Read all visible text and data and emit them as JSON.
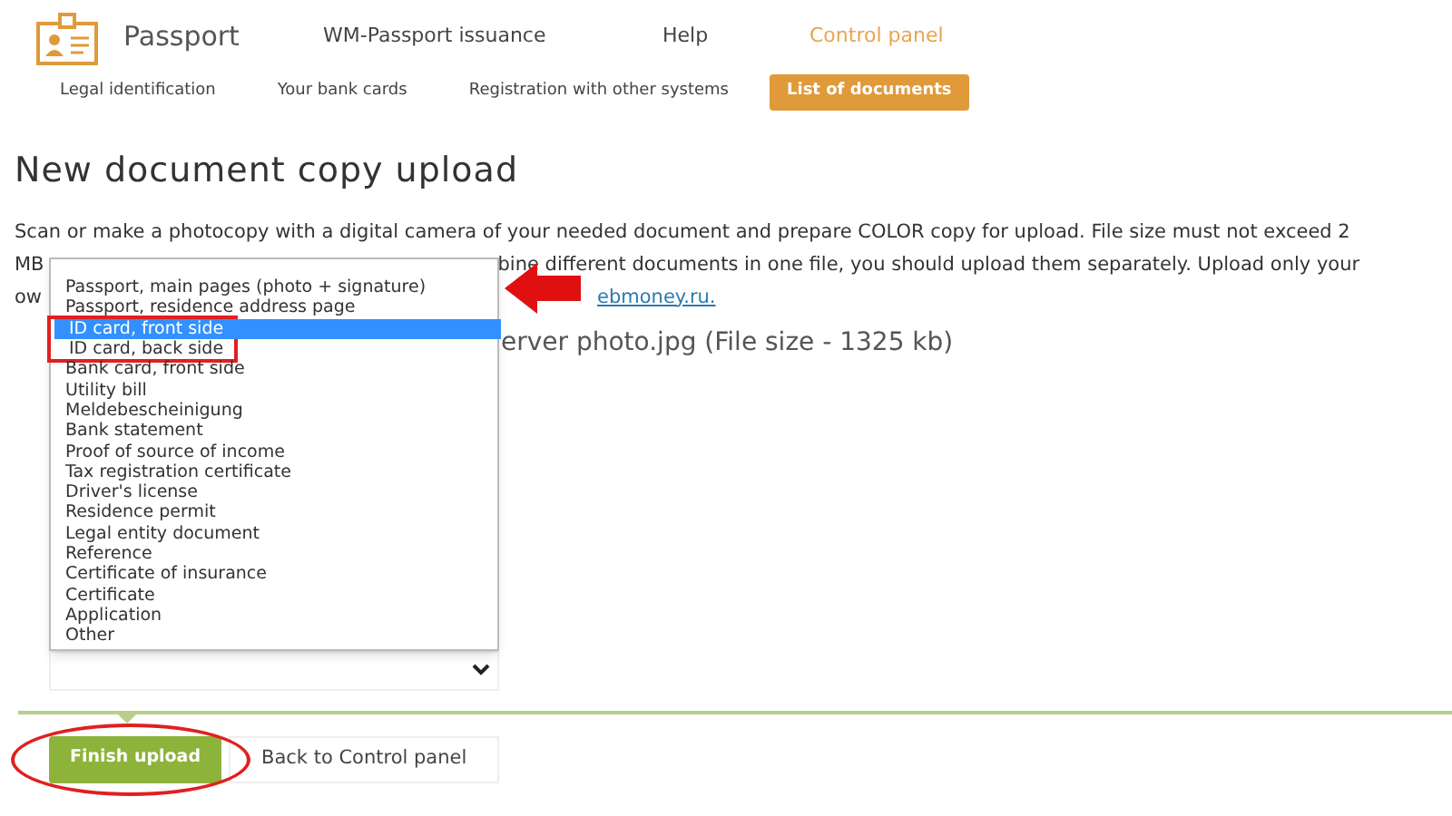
{
  "header": {
    "title": "Passport",
    "nav": [
      {
        "label": "WM-Passport issuance",
        "selected": false
      },
      {
        "label": "Help",
        "selected": false
      },
      {
        "label": "Control panel",
        "selected": true
      }
    ]
  },
  "subnav": [
    {
      "label": "Legal identification",
      "selected": false
    },
    {
      "label": "Your bank cards",
      "selected": false
    },
    {
      "label": "Registration with other systems",
      "selected": false
    },
    {
      "label": "List of documents",
      "selected": true
    }
  ],
  "heading": "New document copy upload",
  "instructions": {
    "line_1": "Scan or make a photocopy with a digital camera of your needed document and prepare COLOR copy for upload. File size must not exceed 2",
    "line_2_start": "MB",
    "line_2_end": "bine different documents in one file, you should upload them separately. Upload only your",
    "line_3_start": "ow",
    "line_3_link": "ebmoney.ru."
  },
  "file_info": "erver photo.jpg (File size - 1325 kb)",
  "document_select": {
    "options": [
      {
        "label": "Passport, main pages (photo + signature)",
        "selected": false
      },
      {
        "label": "Passport, residence address page",
        "selected": false
      },
      {
        "label": "ID card, front side",
        "selected": true
      },
      {
        "label": "ID card, back side",
        "selected": false
      },
      {
        "label": "Bank card, front side",
        "selected": false
      },
      {
        "label": "Utility bill",
        "selected": false
      },
      {
        "label": "Meldebescheinigung",
        "selected": false
      },
      {
        "label": "Bank statement",
        "selected": false
      },
      {
        "label": "Proof of source of income",
        "selected": false
      },
      {
        "label": "Tax registration certificate",
        "selected": false
      },
      {
        "label": "Driver's license",
        "selected": false
      },
      {
        "label": "Residence permit",
        "selected": false
      },
      {
        "label": "Legal entity document",
        "selected": false
      },
      {
        "label": "Reference",
        "selected": false
      },
      {
        "label": "Certificate of insurance",
        "selected": false
      },
      {
        "label": "Certificate",
        "selected": false
      },
      {
        "label": "Application",
        "selected": false
      },
      {
        "label": "Other",
        "selected": false
      }
    ]
  },
  "buttons": {
    "finish": "Finish upload",
    "back": "Back to Control panel"
  }
}
